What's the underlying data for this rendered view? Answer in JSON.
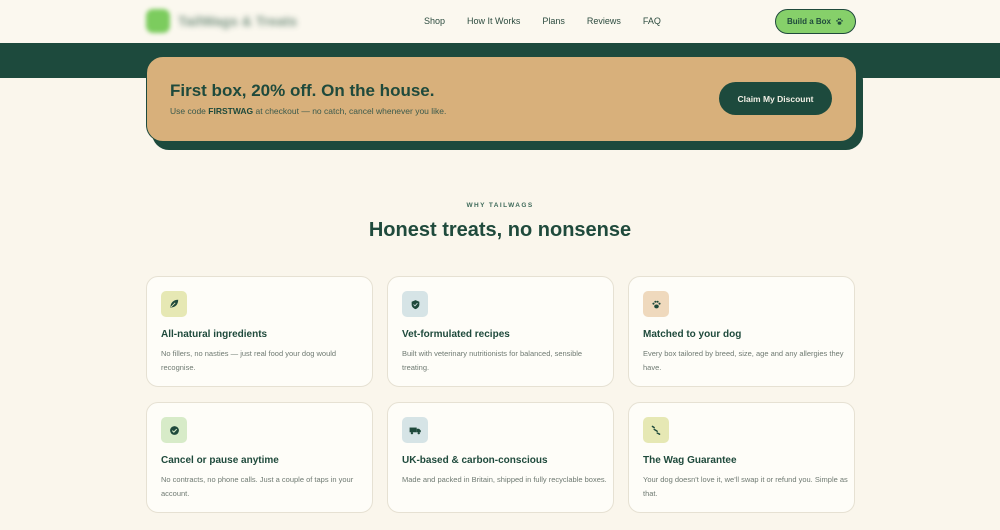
{
  "nav": {
    "brand": "TailWags & Treats",
    "links": [
      "Shop",
      "How It Works",
      "Plans",
      "Reviews",
      "FAQ"
    ],
    "cta_label": "Build a Box",
    "cta_icon": "paw-icon"
  },
  "promo": {
    "title": "First box, 20% off. On the house.",
    "sub_before": "Use code ",
    "code": "FIRSTWAG",
    "sub_after": " at checkout — no catch, cancel whenever you like.",
    "button_label": "Claim My Discount"
  },
  "features": {
    "eyebrow": "WHY TAILWAGS",
    "title": "Honest treats, no nonsense",
    "cards": [
      {
        "title": "All-natural ingredients",
        "desc": "No fillers, no nasties — just real food your dog would recognise.",
        "icon": "leaf-icon",
        "icon_bg": "#e6e8b4"
      },
      {
        "title": "Vet-formulated recipes",
        "desc": "Built with veterinary nutritionists for balanced, sensible treating.",
        "icon": "shield-icon",
        "icon_bg": "#d6e4e6"
      },
      {
        "title": "Matched to your dog",
        "desc": "Every box tailored by breed, size, age and any allergies they have.",
        "icon": "paw-icon",
        "icon_bg": "#efd9bd"
      },
      {
        "title": "Cancel or pause anytime",
        "desc": "No contracts, no phone calls. Just a couple of taps in your account.",
        "icon": "check-circle-icon",
        "icon_bg": "#d7ebc8"
      },
      {
        "title": "UK-based & carbon-conscious",
        "desc": "Made and packed in Britain, shipped in fully recyclable boxes.",
        "icon": "truck-icon",
        "icon_bg": "#d6e4e6"
      },
      {
        "title": "The Wag Guarantee",
        "desc": "Your dog doesn't love it, we'll swap it or refund you. Simple as that.",
        "icon": "bone-icon",
        "icon_bg": "#e6e8b4"
      }
    ]
  }
}
